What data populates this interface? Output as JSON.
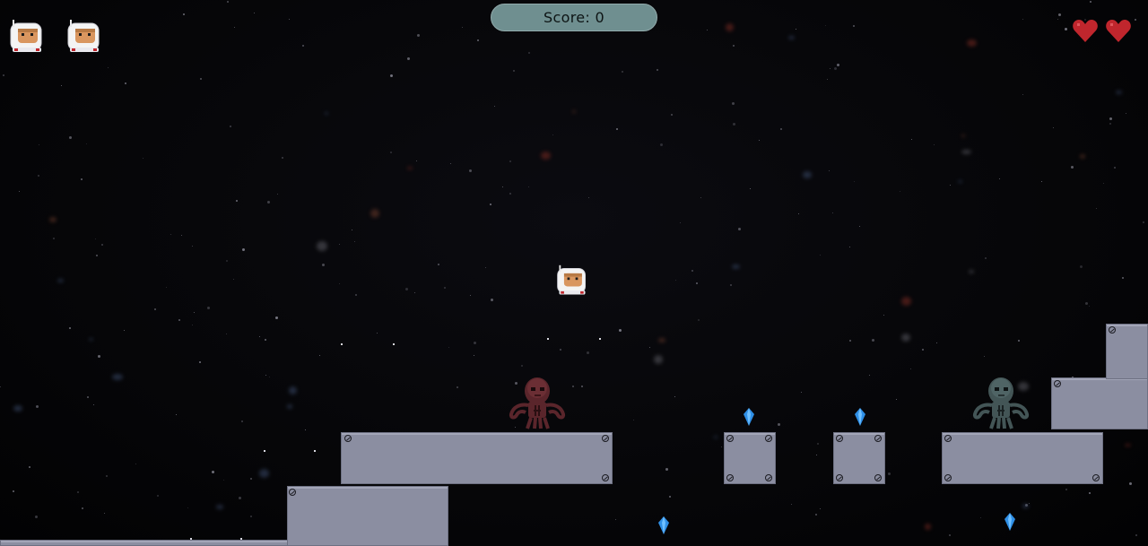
{
  "hud": {
    "score_label": "Score:",
    "score_value": "0",
    "lives": 2,
    "health_hearts": 2
  },
  "icons": {
    "life": "astronaut-life-icon",
    "heart": "heart-icon",
    "player": "astronaut-player-icon",
    "enemy": "alien-octopus-icon",
    "crystal": "blue-crystal-icon"
  },
  "colors": {
    "score_pill": "#6f8f90",
    "platform": "#8b8ea1",
    "heart": "#c0262d",
    "crystal": "#2f8fe6",
    "enemy_red": "#6b2e34",
    "enemy_teal": "#4f6465"
  }
}
